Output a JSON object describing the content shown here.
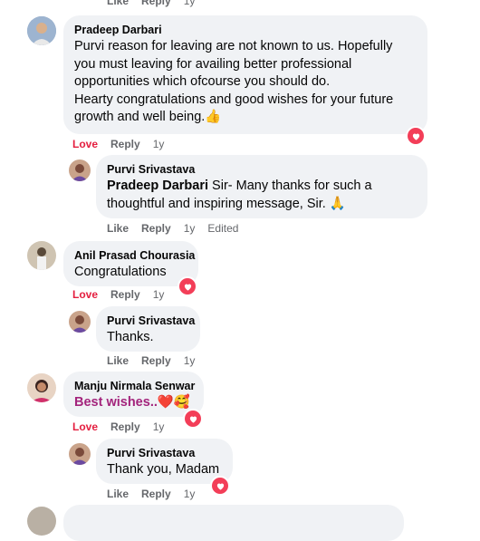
{
  "actions": {
    "like": "Like",
    "love": "Love",
    "reply": "Reply",
    "time": "1y",
    "edited": "Edited"
  },
  "comments": [
    {
      "author": "Pradeep Darbari",
      "lines": [
        "Purvi reason for leaving are not known to us. Hopefully",
        "you must leaving for availing better professional",
        "opportunities which ofcourse you should do.",
        "Hearty congratulations and good wishes for your future",
        "growth and well being."
      ],
      "emoji": "👍",
      "reaction": "heart-icon"
    },
    {
      "author": "Purvi Srivastava",
      "mention": "Pradeep Darbari",
      "line1": " Sir- Many thanks for such a",
      "line2": "thoughtful and inspiring message, Sir. ",
      "emoji": "🙏"
    },
    {
      "author": "Anil Prasad Chourasia",
      "text": "Congratulations",
      "reaction": "heart-icon"
    },
    {
      "author": "Purvi Srivastava",
      "text": "Thanks."
    },
    {
      "author": "Manju Nirmala Senwar",
      "text": "Best wishes..",
      "emoji": "❤️🥰",
      "reaction": "heart-icon"
    },
    {
      "author": "Purvi Srivastava",
      "text": "Thank you, Madam",
      "reaction": "heart-icon"
    }
  ],
  "colors": {
    "bubble": "#f0f2f5",
    "love": "#e41e3f",
    "meta": "#65676b",
    "heart": "#f33e58"
  }
}
